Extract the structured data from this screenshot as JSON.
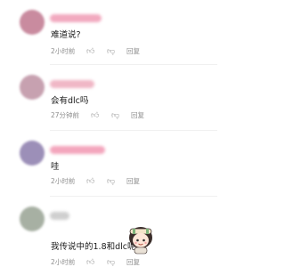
{
  "comments": [
    {
      "text": "难道说?",
      "time": "2小时前",
      "like_icon": "thumb-up-icon",
      "dislike_icon": "thumb-down-icon",
      "reply": "回复",
      "avatar_color": "#c98b9f",
      "name_color": "#f2a9bf"
    },
    {
      "text": "会有dlc吗",
      "time": "27分钟前",
      "like_icon": "thumb-up-icon",
      "dislike_icon": "thumb-down-icon",
      "reply": "回复",
      "avatar_color": "#c7a1b0",
      "name_color": "#f0b7c6"
    },
    {
      "text": "哇",
      "time": "2小时前",
      "like_icon": "thumb-up-icon",
      "dislike_icon": "thumb-down-icon",
      "reply": "回复",
      "avatar_color": "#9c8fb8",
      "name_color": "#f3a6bd"
    },
    {
      "text": "我传说中的1.8和dlc呢",
      "time": "2小时前",
      "like_icon": "thumb-up-icon",
      "dislike_icon": "thumb-down-icon",
      "reply": "回复",
      "avatar_color": "#a7b0a3",
      "name_color": "#cfcfcf",
      "sticker": "chibi-girl-sticker"
    }
  ]
}
